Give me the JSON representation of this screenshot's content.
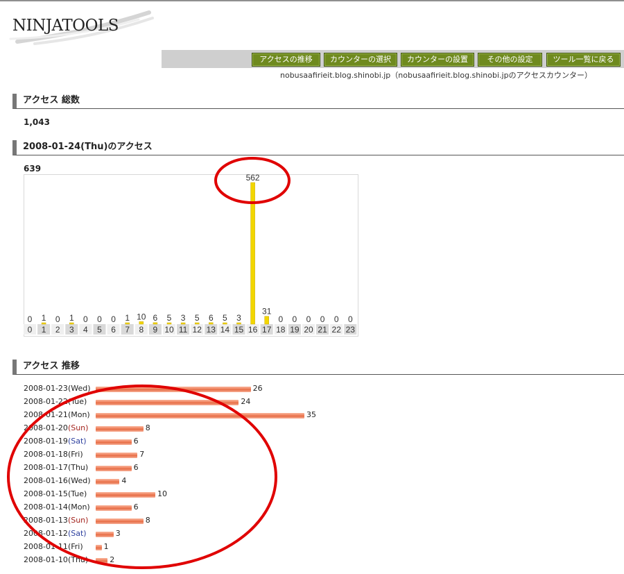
{
  "logo": {
    "text": "NINJATOOLS"
  },
  "nav": {
    "buttons": [
      "アクセスの推移",
      "カウンターの選択",
      "カウンターの設置",
      "その他の設定",
      "ツール一覧に戻る"
    ]
  },
  "subtitle": "nobusaafirieit.blog.shinobi.jp（nobusaafirieit.blog.shinobi.jpのアクセスカウンター）",
  "total": {
    "heading": "アクセス 総数",
    "value": "1,043"
  },
  "daily": {
    "heading": "2008-01-24(Thu)のアクセス",
    "value": "639"
  },
  "trend": {
    "heading": "アクセス 推移",
    "rows": [
      {
        "date": "2008-01-23",
        "day": "(Wed)",
        "value": "26",
        "kind": "weekday"
      },
      {
        "date": "2008-01-22",
        "day": "(Tue)",
        "value": "24",
        "kind": "weekday"
      },
      {
        "date": "2008-01-21",
        "day": "(Mon)",
        "value": "35",
        "kind": "weekday"
      },
      {
        "date": "2008-01-20",
        "day": "(Sun)",
        "value": "8",
        "kind": "sun"
      },
      {
        "date": "2008-01-19",
        "day": "(Sat)",
        "value": "6",
        "kind": "sat"
      },
      {
        "date": "2008-01-18",
        "day": "(Fri)",
        "value": "7",
        "kind": "weekday"
      },
      {
        "date": "2008-01-17",
        "day": "(Thu)",
        "value": "6",
        "kind": "weekday"
      },
      {
        "date": "2008-01-16",
        "day": "(Wed)",
        "value": "4",
        "kind": "weekday"
      },
      {
        "date": "2008-01-15",
        "day": "(Tue)",
        "value": "10",
        "kind": "weekday"
      },
      {
        "date": "2008-01-14",
        "day": "(Mon)",
        "value": "6",
        "kind": "weekday"
      },
      {
        "date": "2008-01-13",
        "day": "(Sun)",
        "value": "8",
        "kind": "sun"
      },
      {
        "date": "2008-01-12",
        "day": "(Sat)",
        "value": "3",
        "kind": "sat"
      },
      {
        "date": "2008-01-11",
        "day": "(Fri)",
        "value": "1",
        "kind": "weekday"
      },
      {
        "date": "2008-01-10",
        "day": "(Thu)",
        "value": "2",
        "kind": "weekday"
      }
    ]
  },
  "colors": {
    "nav_button": "#6f8a1f",
    "hour_bar": "#f2d600",
    "trend_bar": "#e56c45",
    "annotation": "#e00000",
    "sat_text": "#2c3f9e",
    "sun_text": "#a3231d"
  },
  "chart_data": {
    "type": "bar",
    "categories": [
      "0",
      "1",
      "2",
      "3",
      "4",
      "5",
      "6",
      "7",
      "8",
      "9",
      "10",
      "11",
      "12",
      "13",
      "14",
      "15",
      "16",
      "17",
      "18",
      "19",
      "20",
      "21",
      "22",
      "23"
    ],
    "values": [
      0,
      1,
      0,
      1,
      0,
      0,
      0,
      1,
      10,
      6,
      5,
      3,
      5,
      6,
      5,
      3,
      562,
      31,
      0,
      0,
      0,
      0,
      0,
      0
    ],
    "title": "",
    "xlabel": "",
    "ylabel": "",
    "ylim": [
      0,
      562
    ]
  }
}
